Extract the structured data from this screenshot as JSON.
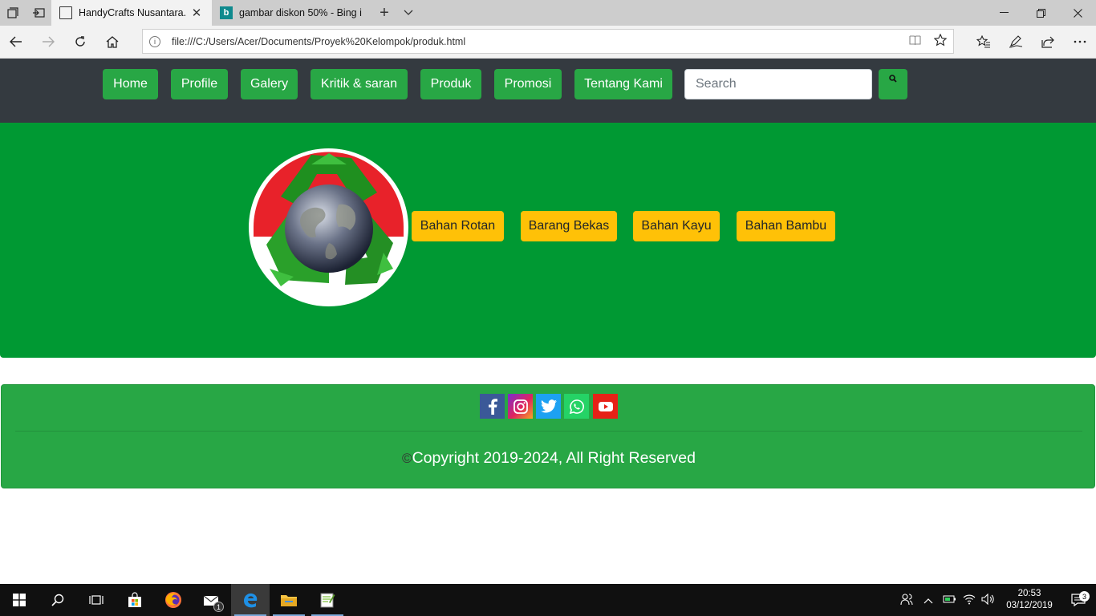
{
  "browser": {
    "tabs": [
      {
        "title": "HandyCrafts Nusantara.",
        "active": true
      },
      {
        "title": "gambar diskon 50% - Bing i",
        "active": false
      }
    ],
    "url": "file:///C:/Users/Acer/Documents/Proyek%20Kelompok/produk.html"
  },
  "navbar": {
    "links": [
      "Home",
      "Profile",
      "Galery",
      "Kritik & saran",
      "Produk",
      "Promosi",
      "Tentang Kami"
    ],
    "search_placeholder": "Search"
  },
  "hero": {
    "categories": [
      "Bahan Rotan",
      "Barang Bekas",
      "Bahan Kayu",
      "Bahan Bambu"
    ]
  },
  "footer": {
    "social": [
      "facebook-icon",
      "instagram-icon",
      "twitter-icon",
      "whatsapp-icon",
      "youtube-icon"
    ],
    "copyright_symbol": "©",
    "copyright": "Copyright 2019-2024, All Right Reserved"
  },
  "taskbar": {
    "time": "20:53",
    "date": "03/12/2019",
    "mail_badge": "1",
    "notification_count": "3"
  },
  "colors": {
    "nav_bg": "#343a40",
    "primary_green": "#28a745",
    "hero_green": "#009933",
    "category_yellow": "#ffc107"
  }
}
